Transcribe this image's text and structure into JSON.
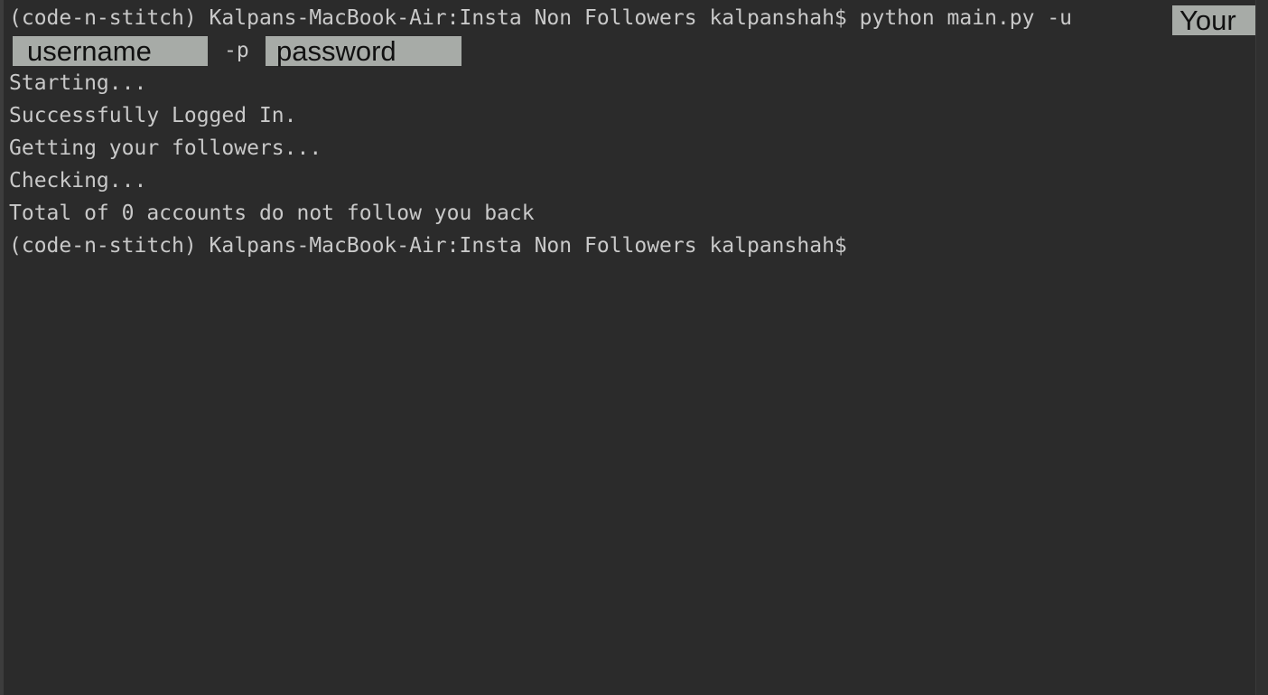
{
  "terminal": {
    "command_line": {
      "prompt": "(code-n-stitch) Kalpans-MacBook-Air:Insta Non Followers kalpanshah$",
      "command": "python main.py -u",
      "username_value_line1": "Your",
      "username_value_line2": "username",
      "password_flag": "-p",
      "password_value": "password"
    },
    "output": [
      "Starting...",
      "Successfully Logged In.",
      "Getting your followers...",
      "Checking...",
      "Total of 0 accounts do not follow you back"
    ],
    "final_prompt": "(code-n-stitch) Kalpans-MacBook-Air:Insta Non Followers kalpanshah$"
  }
}
